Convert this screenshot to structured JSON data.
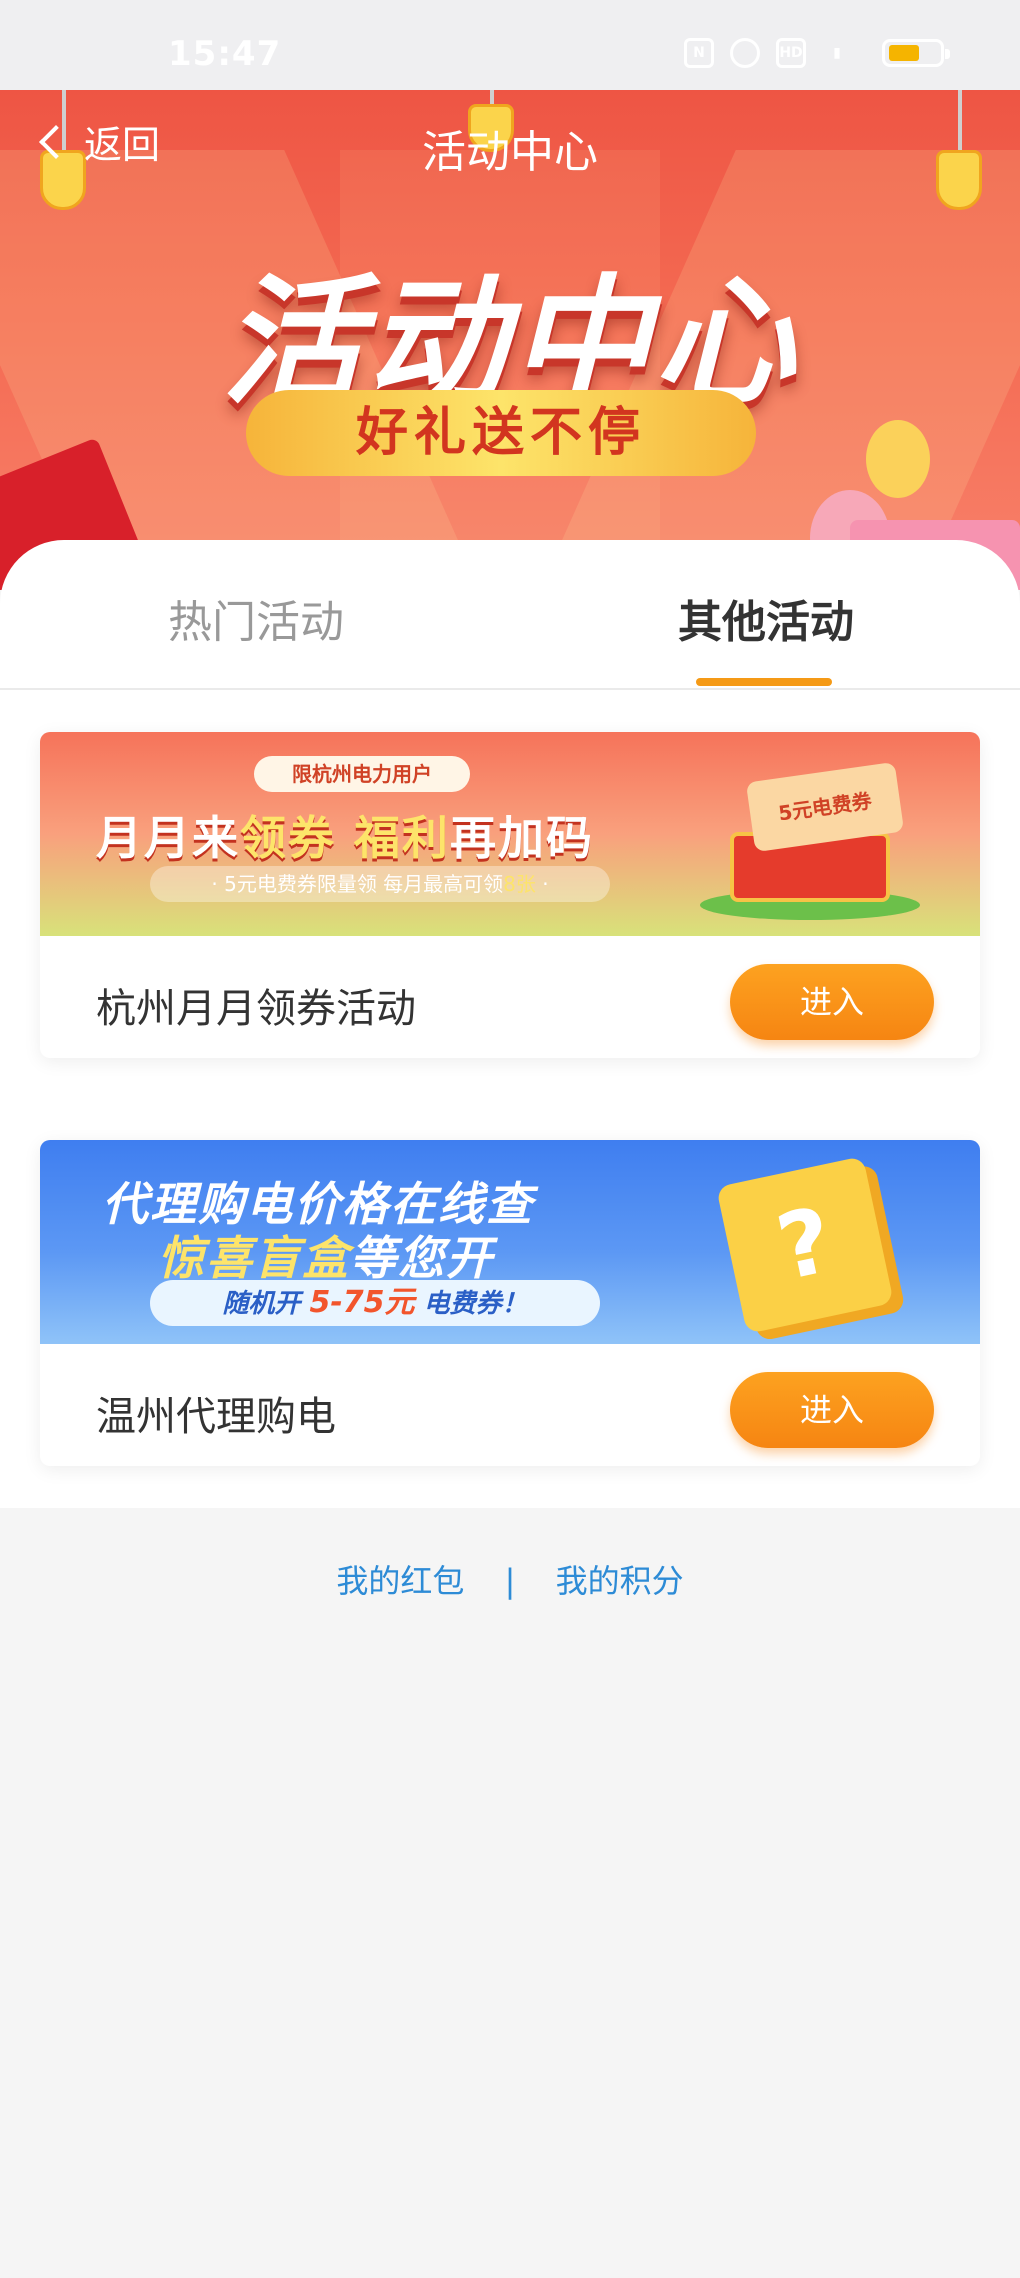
{
  "status_bar": {
    "time": "15:47"
  },
  "header": {
    "back_label": "返回",
    "title": "活动中心"
  },
  "banner": {
    "headline": "活动中心",
    "subtitle": "好礼送不停"
  },
  "tabs": [
    {
      "label": "热门活动",
      "active": false
    },
    {
      "label": "其他活动",
      "active": true
    }
  ],
  "activities": [
    {
      "name": "杭州月月领券活动",
      "button_label": "进入",
      "image": {
        "tag": "限杭州电力用户",
        "headline_a": "月月来",
        "headline_b": "领券",
        "headline_c": "福利",
        "headline_d": "再加码",
        "sub_a": "· 5元电费券限量领 每月最高可领",
        "sub_b": "8张",
        "sub_c": " ·",
        "chest_label": "5元电费券"
      }
    },
    {
      "name": "温州代理购电",
      "button_label": "进入",
      "image": {
        "line1": "代理购电价格在线查",
        "line2_a": "惊喜盲盒",
        "line2_b": "等您开",
        "pill_a": "随机开 ",
        "pill_b": "5-75元",
        "pill_c": " 电费券！"
      }
    }
  ],
  "footer": {
    "link_red_packet": "我的红包",
    "separator": "|",
    "link_points": "我的积分"
  },
  "colors": {
    "accent_orange": "#f68512",
    "banner_red": "#ee5544",
    "link_blue": "#2d8bd6"
  }
}
